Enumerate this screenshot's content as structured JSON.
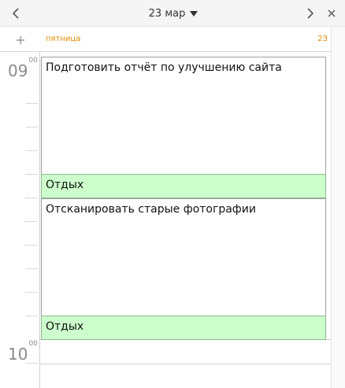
{
  "header": {
    "date": "23 мар"
  },
  "day": {
    "weekday": "пятница",
    "number": "23"
  },
  "hours": [
    {
      "h": "09",
      "m": "00"
    },
    {
      "h": "10",
      "m": "00"
    }
  ],
  "events": [
    {
      "title": "Подготовить отчёт по улучшению сайта",
      "kind": "task"
    },
    {
      "title": "Отдых",
      "kind": "rest"
    },
    {
      "title": "Отсканировать старые фотографии",
      "kind": "task"
    },
    {
      "title": "Отдых",
      "kind": "rest"
    }
  ],
  "colors": {
    "accent": "#e08a00",
    "rest_event_bg": "#ccffcc"
  }
}
